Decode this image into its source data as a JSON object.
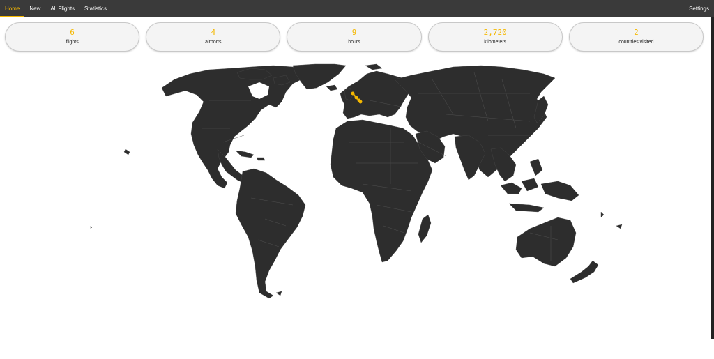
{
  "nav": {
    "home": "Home",
    "new": "New",
    "all_flights": "All Flights",
    "statistics": "Statistics",
    "settings": "Settings",
    "active": "home"
  },
  "stats": [
    {
      "value": "6",
      "label": "flights"
    },
    {
      "value": "4",
      "label": "airports"
    },
    {
      "value": "9",
      "label": "hours"
    },
    {
      "value": "2,720",
      "label": "kilometers"
    },
    {
      "value": "2",
      "label": "countries visited"
    }
  ],
  "colors": {
    "accent": "#f5b800",
    "navbar": "#3a3a3a",
    "land": "#2d2d2d",
    "card": "#f4f4f4"
  },
  "map": {
    "icon": "world-map",
    "routes": [
      {
        "from": "airport-1",
        "to": "airport-2"
      },
      {
        "from": "airport-2",
        "to": "airport-3"
      },
      {
        "from": "airport-3",
        "to": "airport-4"
      }
    ]
  }
}
